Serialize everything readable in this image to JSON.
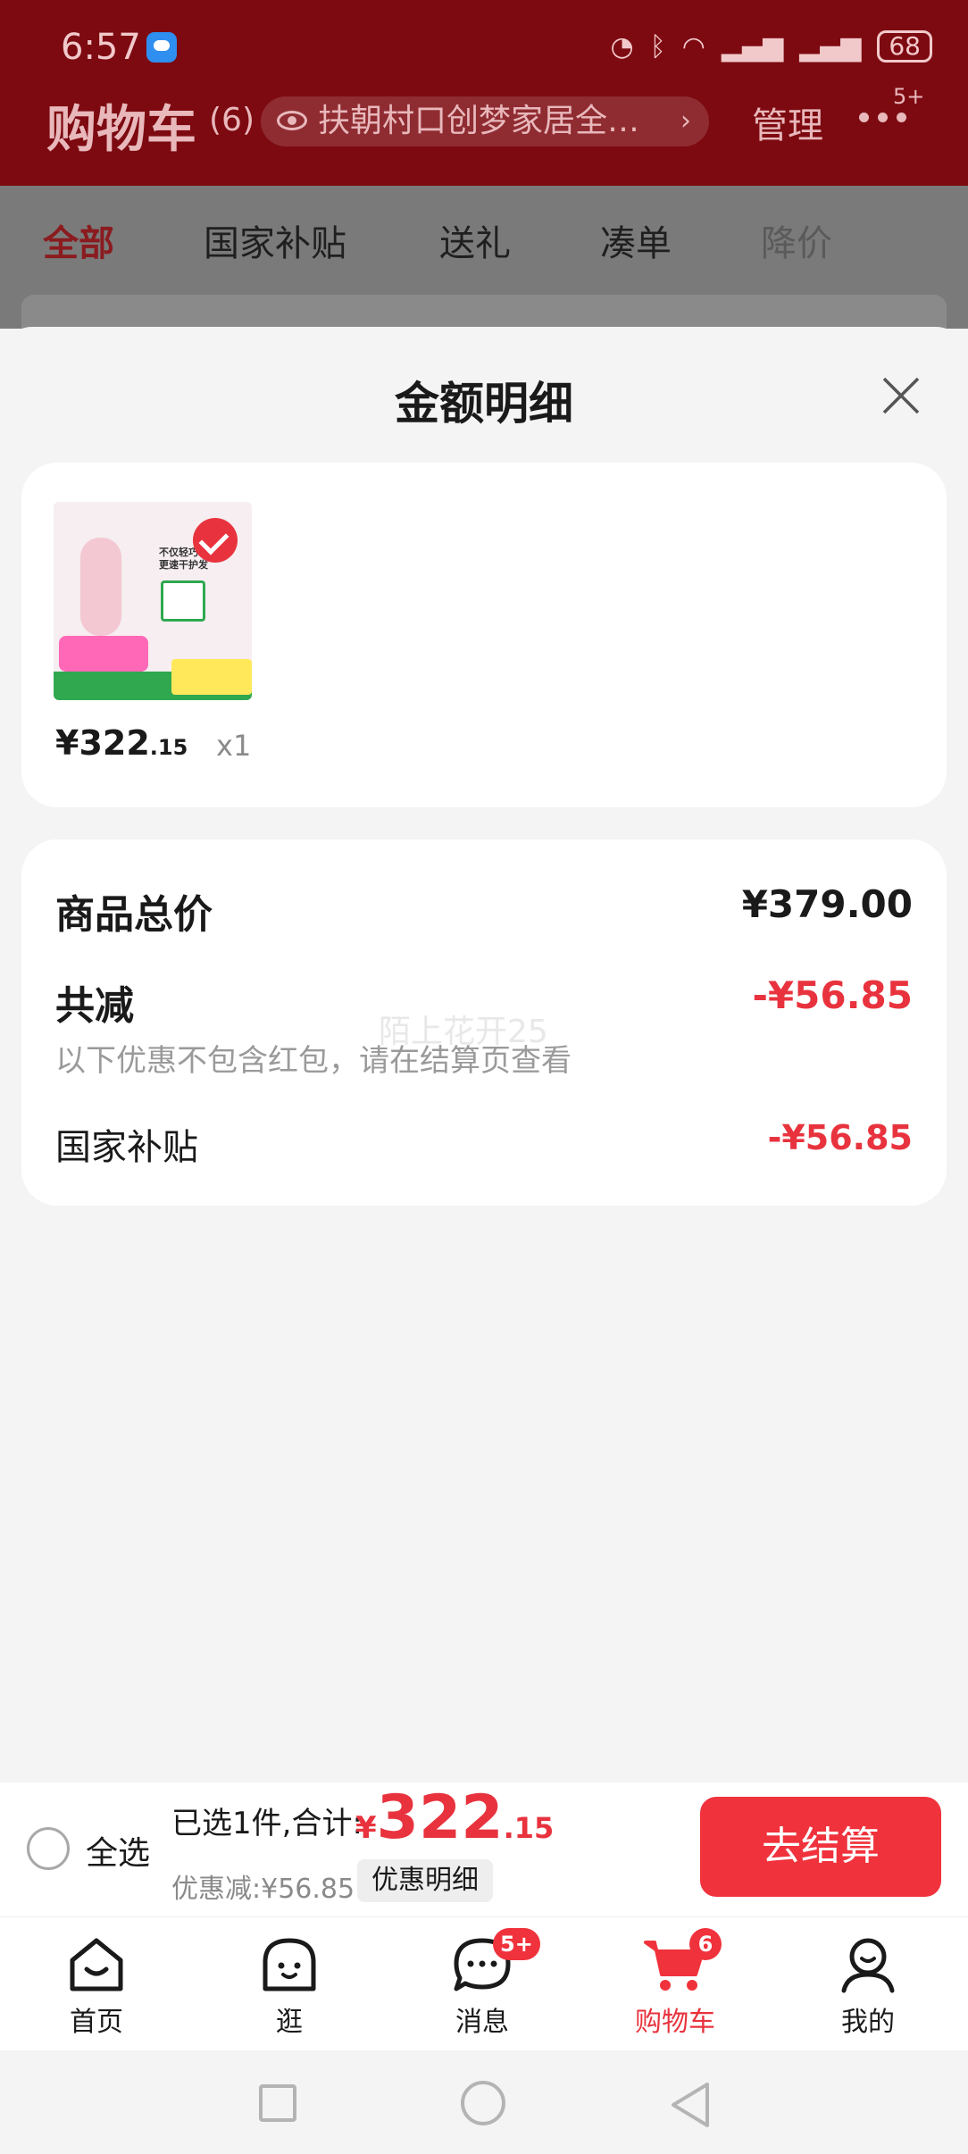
{
  "status_bar": {
    "time": "6:57",
    "battery": "68",
    "signal_note": "6"
  },
  "header": {
    "title": "购物车",
    "count": "(6)",
    "address": "扶朝村口创梦家居全…",
    "manage": "管理",
    "more_badge": "5+"
  },
  "category_tabs": [
    {
      "label": "全部"
    },
    {
      "label": "国家补贴"
    },
    {
      "label": "送礼"
    },
    {
      "label": "凑单"
    },
    {
      "label": "降价"
    }
  ],
  "sheet": {
    "title": "金额明细",
    "product": {
      "price_int": "¥322",
      "price_dec": ".15",
      "quantity": "x1"
    },
    "summary": {
      "total_label": "商品总价",
      "total_value": "¥379.00",
      "discount_label": "共减",
      "discount_value": "-¥56.85",
      "note": "以下优惠不包含红包，请在结算页查看",
      "subsidy_label": "国家补贴",
      "subsidy_value": "-¥56.85",
      "watermark": "陌上花开25"
    }
  },
  "checkout": {
    "select_all": "全选",
    "selected_text": "已选1件,合计:",
    "total_yen": "¥",
    "total_int": "322",
    "total_dec": ".15",
    "discount_text": "优惠减:¥56.85",
    "detail_button": "优惠明细",
    "checkout_button": "去结算"
  },
  "tabbar": {
    "items": [
      {
        "label": "首页",
        "icon": "home-icon"
      },
      {
        "label": "逛",
        "icon": "browse-icon"
      },
      {
        "label": "消息",
        "icon": "message-icon",
        "badge": "5+"
      },
      {
        "label": "购物车",
        "icon": "cart-icon",
        "badge": "6"
      },
      {
        "label": "我的",
        "icon": "profile-icon"
      }
    ]
  },
  "colors": {
    "accent": "#f0323c",
    "price_red": "#e8333e",
    "header_red": "#7d0a11"
  }
}
